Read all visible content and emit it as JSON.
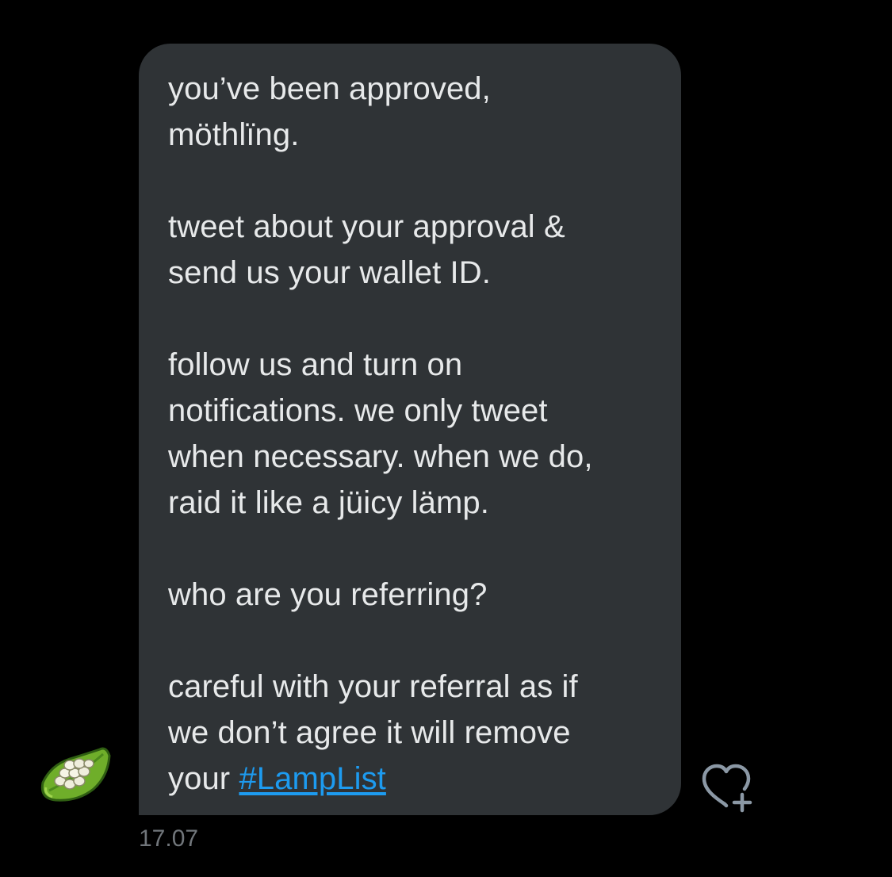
{
  "message": {
    "paragraphs": [
      "you’ve been approved,\nmöthlïng.",
      "tweet about your approval &\nsend us your wallet ID.",
      "follow us and turn on\nnotifications. we only tweet\nwhen necessary. when we do,\nraid it like a jüicy lämp.",
      "who are you referring?"
    ],
    "last_paragraph_text": "careful with your referral as if\nwe don’t agree it will remove\nyour ",
    "hashtag": "#LampList",
    "timestamp": "17.07"
  },
  "icons": {
    "avatar": "lamp-avatar-icon",
    "reaction": "heart-plus-icon"
  },
  "colors": {
    "background": "#000000",
    "bubble": "#2f3336",
    "text": "#e7e9ea",
    "link": "#1d9bf0",
    "muted": "#71767b"
  }
}
